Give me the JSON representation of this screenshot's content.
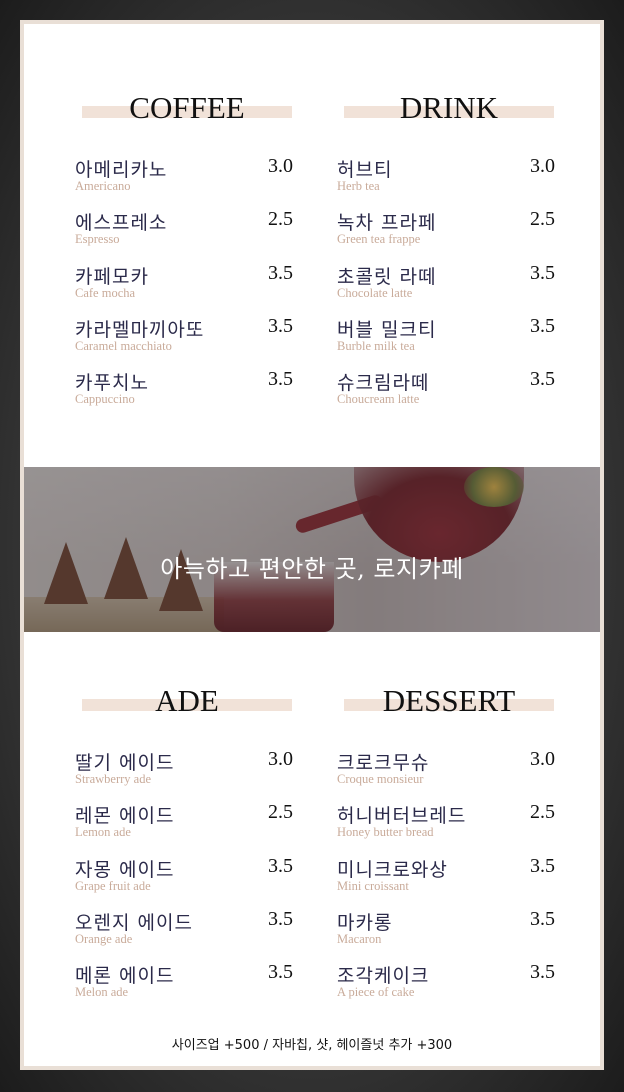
{
  "sections": {
    "coffee": {
      "title": "COFFEE",
      "items": [
        {
          "name": "아메리카노",
          "sub": "Americano",
          "price": "3.0"
        },
        {
          "name": "에스프레소",
          "sub": "Espresso",
          "price": "2.5"
        },
        {
          "name": "카페모카",
          "sub": "Cafe mocha",
          "price": "3.5"
        },
        {
          "name": "카라멜마끼아또",
          "sub": "Caramel macchiato",
          "price": "3.5"
        },
        {
          "name": "카푸치노",
          "sub": "Cappuccino",
          "price": "3.5"
        }
      ]
    },
    "drink": {
      "title": "DRINK",
      "items": [
        {
          "name": "허브티",
          "sub": "Herb tea",
          "price": "3.0"
        },
        {
          "name": "녹차 프라페",
          "sub": "Green tea frappe",
          "price": "2.5"
        },
        {
          "name": "초콜릿 라떼",
          "sub": "Chocolate latte",
          "price": "3.5"
        },
        {
          "name": "버블 밀크티",
          "sub": "Burble milk tea",
          "price": "3.5"
        },
        {
          "name": "슈크림라떼",
          "sub": "Choucream latte",
          "price": "3.5"
        }
      ]
    },
    "ade": {
      "title": "ADE",
      "items": [
        {
          "name": "딸기 에이드",
          "sub": "Strawberry ade",
          "price": "3.0"
        },
        {
          "name": "레몬 에이드",
          "sub": "Lemon ade",
          "price": "2.5"
        },
        {
          "name": "자몽 에이드",
          "sub": "Grape fruit ade",
          "price": "3.5"
        },
        {
          "name": "오렌지 에이드",
          "sub": "Orange ade",
          "price": "3.5"
        },
        {
          "name": "메론 에이드",
          "sub": "Melon ade",
          "price": "3.5"
        }
      ]
    },
    "dessert": {
      "title": "DESSERT",
      "items": [
        {
          "name": "크로크무슈",
          "sub": "Croque monsieur",
          "price": "3.0"
        },
        {
          "name": "허니버터브레드",
          "sub": "Honey butter bread",
          "price": "2.5"
        },
        {
          "name": "미니크로와상",
          "sub": "Mini croissant",
          "price": "3.5"
        },
        {
          "name": "마카롱",
          "sub": "Macaron",
          "price": "3.5"
        },
        {
          "name": "조각케이크",
          "sub": "A piece of cake",
          "price": "3.5"
        }
      ]
    }
  },
  "banner": {
    "tagline": "아늑하고 편안한 곳, 로지카페"
  },
  "footer": {
    "note": "사이즈업 +500 / 자바칩, 샷, 헤이즐넛 추가 +300"
  },
  "colors": {
    "accent_bar": "#f1e2d8",
    "sub_text": "#c9ab9a",
    "item_name": "#2b2a4a"
  }
}
